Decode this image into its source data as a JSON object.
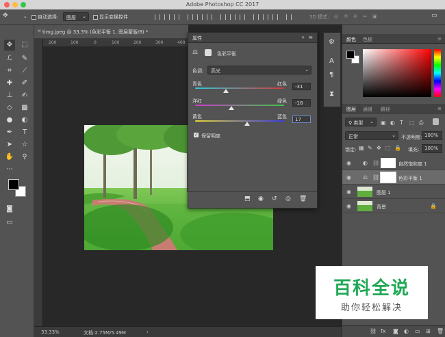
{
  "window": {
    "title": "Adobe Photoshop CC 2017"
  },
  "options_bar": {
    "auto_select_label": "自动选择:",
    "auto_select_value": "图层",
    "show_transform_label": "显示变换控件",
    "mode3d_label": "3D 模式:"
  },
  "document": {
    "tab_title": "timg.jpeg @ 33.3% (色彩平衡 1, 图层蒙版/8) *",
    "ruler_ticks": [
      "200",
      "100",
      "0",
      "100",
      "200",
      "300",
      "400",
      "500",
      "600",
      "700",
      "800"
    ]
  },
  "status": {
    "zoom": "33.33%",
    "doc_info": "文档:2.75M/5.49M"
  },
  "properties": {
    "panel_title": "属性",
    "adjustment_name": "色彩平衡",
    "tone_label": "色调:",
    "tone_value": "高光",
    "sliders": [
      {
        "left": "青色",
        "right": "红色",
        "value": "-31",
        "fraction": 0.345
      },
      {
        "left": "洋红",
        "right": "绿色",
        "value": "-18",
        "fraction": 0.41
      },
      {
        "left": "黄色",
        "right": "蓝色",
        "value": "17",
        "fraction": 0.585
      }
    ],
    "preserve_label": "保留明度"
  },
  "right_panels": {
    "color_tabs": [
      "颜色",
      "色板"
    ],
    "layer_tabs": [
      "图层",
      "通道",
      "路径"
    ],
    "filter_kind": "类型",
    "blend_mode": "正常",
    "opacity_label": "不透明度:",
    "opacity_value": "100%",
    "lock_label": "锁定:",
    "fill_label": "填充:",
    "fill_value": "100%",
    "layers": [
      {
        "name": "自然饱和度 1"
      },
      {
        "name": "色彩平衡 1"
      },
      {
        "name": "图层 1"
      },
      {
        "name": "背景"
      }
    ]
  },
  "watermark": {
    "title": "百科全说",
    "subtitle": "助你轻松解决"
  },
  "colors": {
    "foreground": "#000000",
    "background": "#ffffff",
    "accent": "#1fa855"
  }
}
